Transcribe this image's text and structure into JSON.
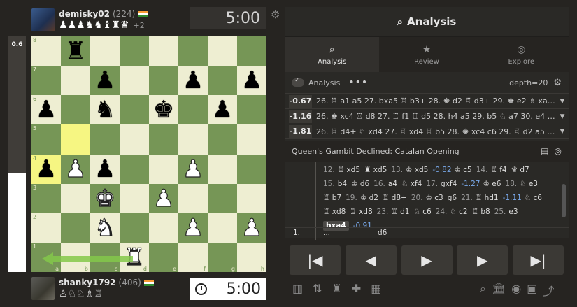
{
  "eval_bar": {
    "value": "0.6",
    "white_fraction": 0.42
  },
  "top_player": {
    "name": "demisky02",
    "rating": "(224)",
    "captured": [
      "♟",
      "♟",
      "♟",
      "♞",
      "♞",
      "♝",
      "♜",
      "♛"
    ],
    "material_diff": "+2"
  },
  "bottom_player": {
    "name": "shanky1792",
    "rating": "(406)",
    "captured": [
      "♙",
      "♘",
      "♘",
      "♗",
      "♖"
    ]
  },
  "clocks": {
    "top": "5:00",
    "bottom": "5:00"
  },
  "board": {
    "rows": [
      [
        "",
        "bR",
        "",
        "",
        "",
        "",
        "",
        ""
      ],
      [
        "",
        "",
        "bP",
        "",
        "",
        "bP",
        "",
        "bP"
      ],
      [
        "bP",
        "",
        "bN",
        "",
        "bK",
        "",
        "bP",
        ""
      ],
      [
        "",
        "",
        "",
        "",
        "",
        "",
        "",
        ""
      ],
      [
        "bP",
        "wP",
        "bP",
        "",
        "",
        "wP",
        "",
        ""
      ],
      [
        "",
        "",
        "wK",
        "",
        "wP",
        "",
        "",
        ""
      ],
      [
        "",
        "",
        "wN",
        "",
        "",
        "wP",
        "",
        "wP"
      ],
      [
        "",
        "",
        "",
        "wR",
        "",
        "",
        "",
        ""
      ]
    ],
    "highlight": [
      [
        3,
        1
      ],
      [
        4,
        0
      ]
    ],
    "ranks": [
      "8",
      "7",
      "6",
      "5",
      "4",
      "3",
      "2",
      "1"
    ],
    "files": [
      "a",
      "b",
      "c",
      "d",
      "e",
      "f",
      "g",
      "h"
    ],
    "arrow_color": "#84c84a"
  },
  "analysis": {
    "title": "Analysis",
    "tabs": [
      {
        "label": "Analysis",
        "icon": "⌕"
      },
      {
        "label": "Review",
        "icon": "★"
      },
      {
        "label": "Explore",
        "icon": "◎"
      }
    ],
    "toggle_label": "Analysis",
    "more": "•••",
    "depth": "depth=20",
    "lines": [
      {
        "score": "-0.67",
        "moves": "26. ♖ a1 a5 27. bxa5 ♖ b3+ 28. ♚ d2 ♖ d3+ 29. ♚ e2 ♗ xa5 30. ♖ ..."
      },
      {
        "score": "-1.16",
        "moves": "26. ♚ xc4 ♖ d8 27. ♖ f1 ♖ d5 28. h4 a5 29. b5 ♘ a7 30. e4 ♖ h5 31...."
      },
      {
        "score": "-1.81",
        "moves": "26. ♖ d4+ ♘ xd4 27. ♖ xd4 ♖ b5 28. ♚ xc4 c6 29. ♖ d2 a5 30. bxa5 ..."
      }
    ],
    "opening": "Queen's Gambit Declined: Catalan Opening",
    "movelist": [
      [
        {
          "n": "12."
        },
        {
          "m": "♖ xd5"
        },
        {
          "m": "♜ xd5"
        },
        {
          "n": "13."
        },
        {
          "m": "♔ xd5"
        },
        {
          "e": "-0.82"
        },
        {
          "m": "♔ c5"
        },
        {
          "n": "14."
        },
        {
          "m": "♖ f4"
        },
        {
          "m": "♛ d7"
        }
      ],
      [
        {
          "n": "15."
        },
        {
          "m": "b4"
        },
        {
          "m": "♔ d6"
        },
        {
          "n": "16."
        },
        {
          "m": "a4"
        },
        {
          "m": "♘ xf4"
        },
        {
          "n": "17."
        },
        {
          "m": "gxf4"
        },
        {
          "e": "-1.27"
        },
        {
          "m": "♔ e6"
        },
        {
          "n": "18."
        },
        {
          "m": "♘ e3"
        }
      ],
      [
        {
          "m": "♖ b7"
        },
        {
          "n": "19."
        },
        {
          "m": "♔ d2"
        },
        {
          "m": "♖ d8+"
        },
        {
          "n": "20."
        },
        {
          "m": "♔ c3"
        },
        {
          "m": "g6"
        },
        {
          "n": "21."
        },
        {
          "m": "♖ hd1"
        },
        {
          "e": "-1.11"
        },
        {
          "m": "♘ c6"
        }
      ],
      [
        {
          "m": "♖ xd8"
        },
        {
          "m": "♖ xd8"
        },
        {
          "n": "23."
        },
        {
          "m": "♖ d1"
        },
        {
          "m": "♘ c6"
        },
        {
          "n": "24."
        },
        {
          "m": "♘ c2"
        },
        {
          "m": "♖ b8"
        },
        {
          "n": "25."
        },
        {
          "m": "e3"
        }
      ]
    ],
    "current_move": "bxa4",
    "current_eval": "-0.91",
    "bottom_move_number": "1.",
    "bottom_dots": "...",
    "bottom_move": "d6"
  },
  "nav": [
    "|◀",
    "◀",
    "▶",
    "▶",
    "▶|"
  ],
  "tools_left": [
    "▥",
    "⇅",
    "♜",
    "✚",
    "▦"
  ],
  "tools_right": [
    "⌕",
    "🏛",
    "◉",
    "▣",
    "⤴"
  ]
}
